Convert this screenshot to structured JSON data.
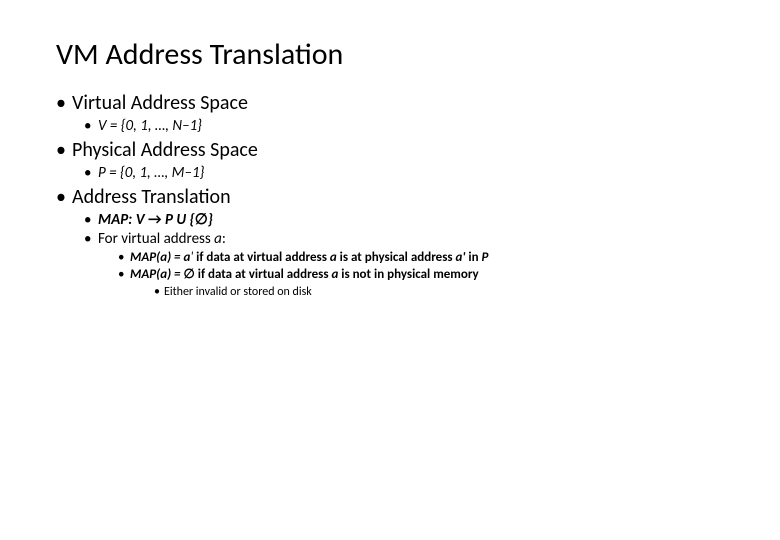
{
  "title": "VM Address Translation",
  "b1": {
    "head": "Virtual Address Space",
    "sub": "V = {0, 1, …, N–1}"
  },
  "b2": {
    "head": "Physical Address Space",
    "sub": "P = {0, 1, …, M–1}"
  },
  "b3": {
    "head": "Address Translation",
    "map_label": "MAP:  V ",
    "map_arrow": "→",
    "map_rest1": " P  U  {",
    "empty1": "∅",
    "map_rest2": "}",
    "for_prefix": "For virtual address ",
    "for_var": "a",
    "for_suffix": ":",
    "case1": {
      "lead": "MAP(a)  =  a",
      "prime": "'",
      "mid1": "  if data at virtual address ",
      "a1": "a",
      "mid2": " is at physical address ",
      "a2": "a'",
      "mid3": " in ",
      "P": "P"
    },
    "case2": {
      "lead": "MAP(a)  = ",
      "empty": "∅",
      "mid1": " if data at virtual address ",
      "a1": "a",
      "mid2": " is not in physical memory"
    },
    "note": "Either invalid or stored on disk"
  }
}
